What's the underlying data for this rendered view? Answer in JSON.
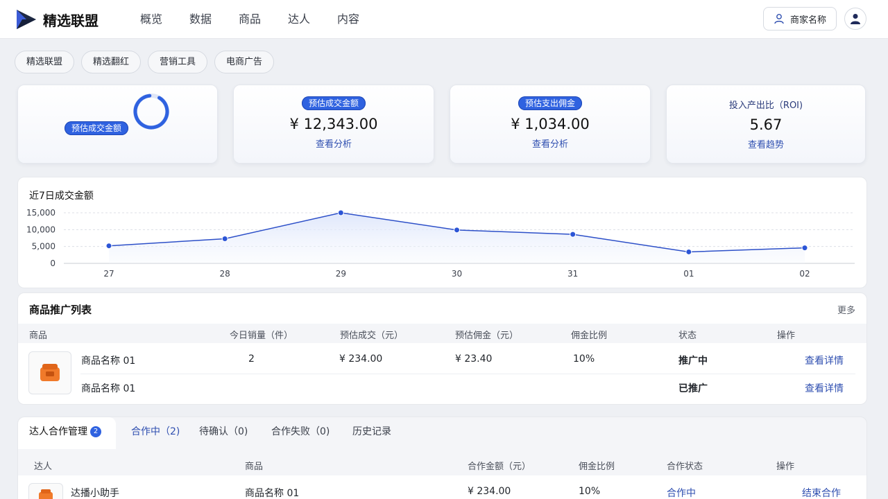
{
  "header": {
    "brand": "精选联盟",
    "nav": [
      "概览",
      "数据",
      "商品",
      "达人",
      "内容"
    ],
    "merchant_label": "商家名称"
  },
  "subtabs": [
    "精选联盟",
    "精选翻红",
    "营销工具",
    "电商广告"
  ],
  "stats": [
    {
      "label": "预估成交金额",
      "value": "",
      "link": ""
    },
    {
      "label": "预估成交金额",
      "value": "¥ 12,343.00",
      "link": "查看分析"
    },
    {
      "label": "预估支出佣金",
      "value": "¥ 1,034.00",
      "link": "查看分析"
    },
    {
      "label": "投入产出比（ROI)",
      "value": "5.67",
      "link": "查看趋势"
    }
  ],
  "chart_data": {
    "type": "line",
    "title": "近7日成交金额",
    "categories": [
      "27",
      "28",
      "29",
      "30",
      "31",
      "01",
      "02"
    ],
    "values": [
      5200,
      7300,
      15000,
      9900,
      8600,
      3400,
      4600
    ],
    "yticks": [
      "15,000",
      "10,000",
      "5,000",
      "0"
    ],
    "ylim": [
      0,
      15000
    ],
    "grid": true
  },
  "product_list": {
    "title": "商品推广列表",
    "more": "更多",
    "columns": [
      "商品",
      "今日销量（件）",
      "预估成交（元）",
      "预估佣金（元）",
      "佣金比例",
      "状态",
      "操作"
    ],
    "rows": [
      {
        "name": "商品名称 01",
        "sales": "2",
        "gmv": "¥ 234.00",
        "commission": "¥ 23.40",
        "rate": "10%",
        "status": "推广中",
        "action": "查看详情"
      },
      {
        "name": "商品名称 01",
        "sales": "",
        "gmv": "",
        "commission": "",
        "rate": "",
        "status": "已推广",
        "action": "查看详情"
      }
    ]
  },
  "talent": {
    "tabs": [
      {
        "label": "达人合作管理",
        "badge": "2"
      },
      {
        "label": "合作中（2)"
      },
      {
        "label": "待确认（0)"
      },
      {
        "label": "合作失败（0)"
      },
      {
        "label": "历史记录"
      }
    ],
    "columns": [
      "达人",
      "商品",
      "合作金额（元）",
      "佣金比例",
      "合作状态",
      "操作"
    ],
    "rows": [
      {
        "talent": "达播小助手",
        "product": "商品名称 01",
        "amount": "¥ 234.00",
        "rate": "10%",
        "status": "合作中",
        "action": "结束合作"
      }
    ]
  },
  "colors": {
    "accent": "#2f62e0",
    "link": "#2f4fb0",
    "line": "#2c4fc8"
  }
}
